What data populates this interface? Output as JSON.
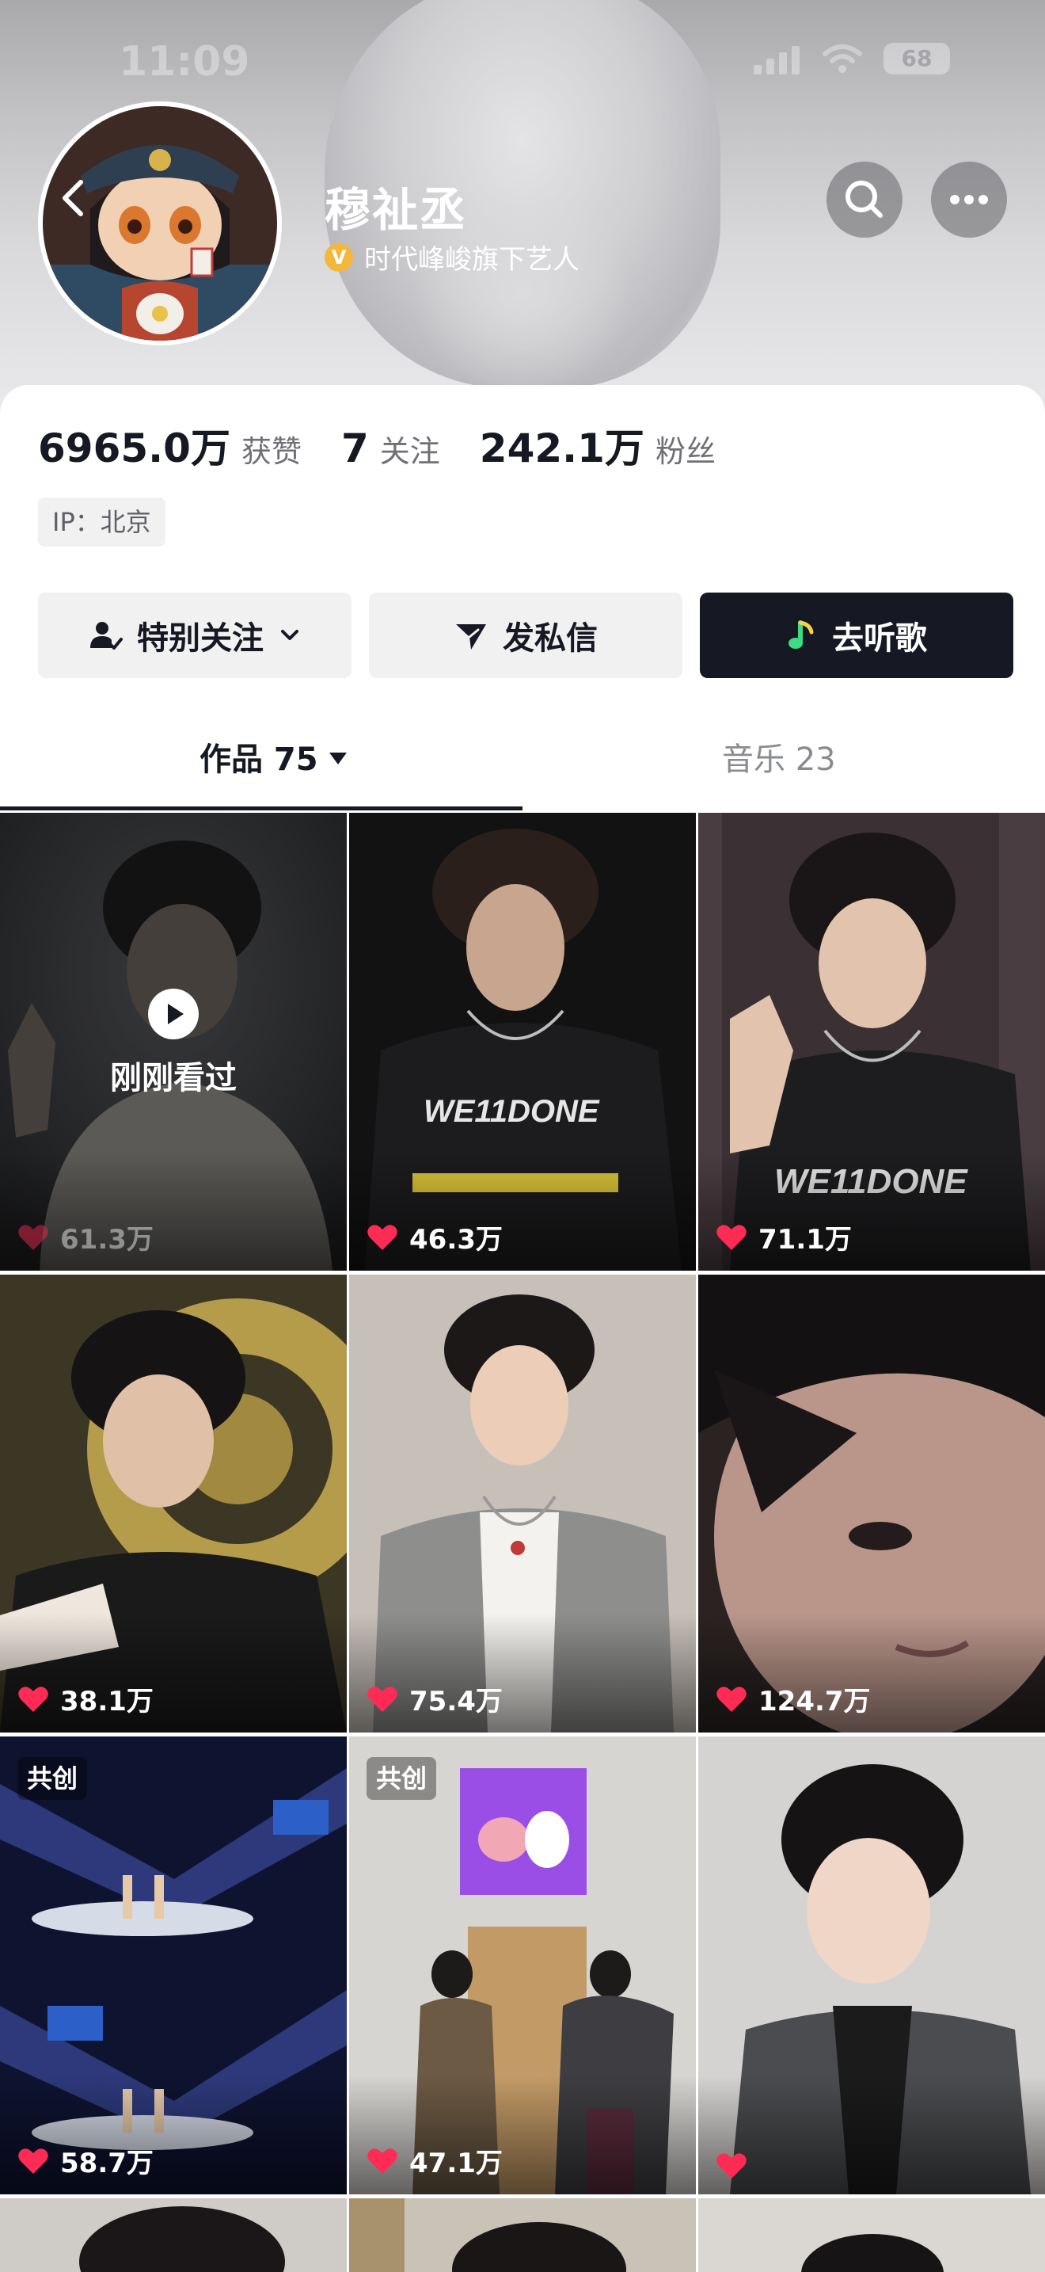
{
  "status_bar": {
    "time": "11:09",
    "battery": "68"
  },
  "profile": {
    "name": "穆祉丞",
    "verify_badge": "V",
    "verification": "时代峰峻旗下艺人",
    "stats": [
      {
        "value": "6965.0万",
        "label": "获赞"
      },
      {
        "value": "7",
        "label": "关注"
      },
      {
        "value": "242.1万",
        "label": "粉丝"
      }
    ],
    "ip": "IP：北京"
  },
  "actions": {
    "follow": "特别关注",
    "message": "发私信",
    "listen": "去听歌"
  },
  "tabs": {
    "works": "作品 75",
    "music": "音乐 23"
  },
  "grid": {
    "watched_label": "刚刚看过",
    "cocreate_label": "共创",
    "shirt_text": "WE11DONE",
    "items": [
      {
        "likes": "61.3万"
      },
      {
        "likes": "46.3万"
      },
      {
        "likes": "71.1万"
      },
      {
        "likes": "38.1万"
      },
      {
        "likes": "75.4万"
      },
      {
        "likes": "124.7万"
      },
      {
        "likes": "58.7万"
      },
      {
        "likes": "47.1万"
      },
      {
        "likes": ""
      }
    ]
  },
  "colors": {
    "heart": "#fe2c55",
    "dark_button": "#161823",
    "badge": "#f5b73b"
  }
}
